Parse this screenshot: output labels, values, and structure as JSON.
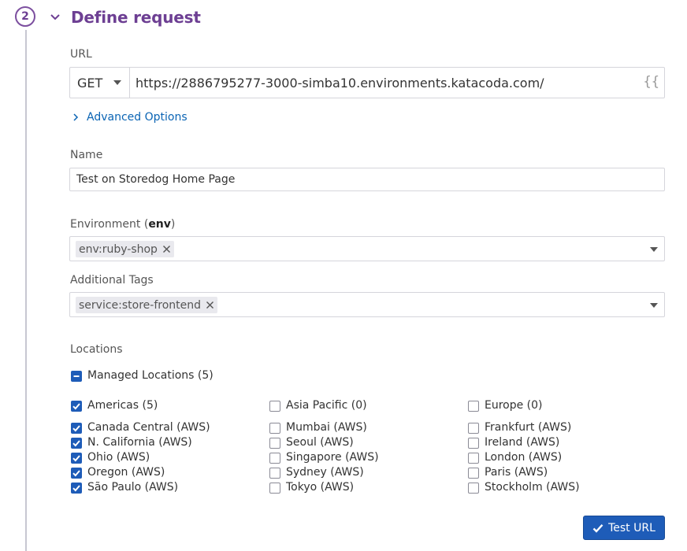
{
  "step": {
    "number": "2",
    "title": "Define request"
  },
  "url_section": {
    "label": "URL",
    "method": "GET",
    "url": "https://2886795277-3000-simba10.environments.katacoda.com/",
    "variable_icon": "{{"
  },
  "advanced_options": {
    "label": "Advanced Options",
    "icon": "chevron-right-icon"
  },
  "name_field": {
    "label": "Name",
    "value": "Test on Storedog Home Page"
  },
  "environment": {
    "label_prefix": "Environment (",
    "label_key": "env",
    "label_suffix": ")",
    "tag": "env:ruby-shop"
  },
  "additional_tags": {
    "label": "Additional Tags",
    "tag": "service:store-frontend"
  },
  "locations": {
    "label": "Locations",
    "managed": {
      "label": "Managed Locations (5)",
      "state": "partial"
    },
    "columns": [
      {
        "header": {
          "label": "Americas (5)",
          "checked": true
        },
        "items": [
          {
            "label": "Canada Central (AWS)",
            "checked": true
          },
          {
            "label": "N. California (AWS)",
            "checked": true
          },
          {
            "label": "Ohio (AWS)",
            "checked": true
          },
          {
            "label": "Oregon (AWS)",
            "checked": true
          },
          {
            "label": "São Paulo (AWS)",
            "checked": true
          }
        ]
      },
      {
        "header": {
          "label": "Asia Pacific (0)",
          "checked": false
        },
        "items": [
          {
            "label": "Mumbai (AWS)",
            "checked": false
          },
          {
            "label": "Seoul (AWS)",
            "checked": false
          },
          {
            "label": "Singapore (AWS)",
            "checked": false
          },
          {
            "label": "Sydney (AWS)",
            "checked": false
          },
          {
            "label": "Tokyo (AWS)",
            "checked": false
          }
        ]
      },
      {
        "header": {
          "label": "Europe (0)",
          "checked": false
        },
        "items": [
          {
            "label": "Frankfurt (AWS)",
            "checked": false
          },
          {
            "label": "Ireland (AWS)",
            "checked": false
          },
          {
            "label": "London (AWS)",
            "checked": false
          },
          {
            "label": "Paris (AWS)",
            "checked": false
          },
          {
            "label": "Stockholm (AWS)",
            "checked": false
          }
        ]
      }
    ]
  },
  "test_button": {
    "label": "Test URL",
    "icon": "check-icon"
  },
  "colors": {
    "accent_purple": "#6d3f93",
    "link_blue": "#0a64b4",
    "primary_blue": "#1e5cb8"
  }
}
